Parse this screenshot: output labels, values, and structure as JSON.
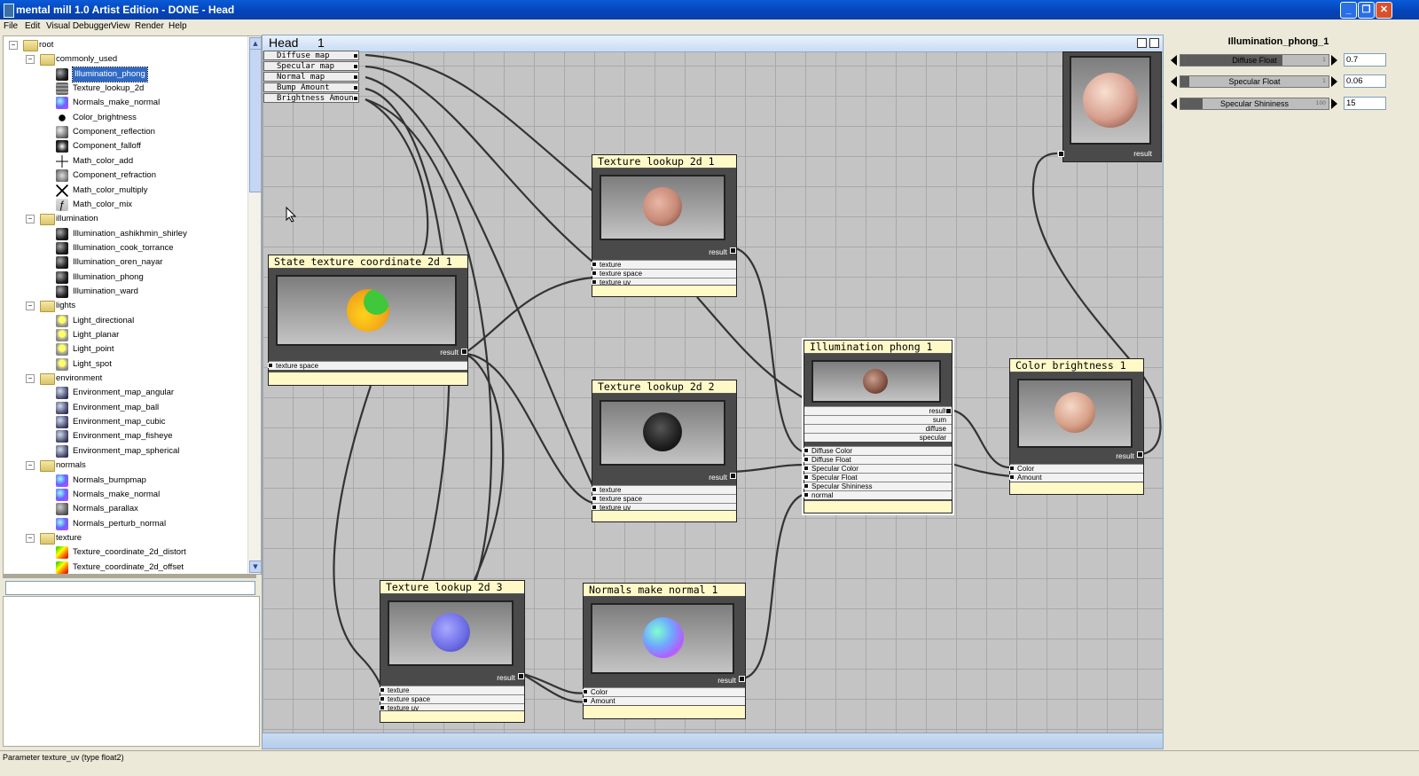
{
  "window": {
    "title": "mental mill 1.0 Artist Edition - DONE - Head"
  },
  "menu": [
    "File",
    "Edit",
    "Visual Debugger",
    "View",
    "Render",
    "Help"
  ],
  "tree": {
    "items": [
      {
        "label": "root",
        "level": 0,
        "type": "folder"
      },
      {
        "label": "commonly_used",
        "level": 1,
        "type": "folder"
      },
      {
        "label": "Illumination_phong",
        "level": 2,
        "type": "item",
        "icon": "dark-sphere-icon",
        "selected": true
      },
      {
        "label": "Texture_lookup_2d",
        "level": 2,
        "type": "item",
        "icon": "texture-grid-icon"
      },
      {
        "label": "Normals_make_normal",
        "level": 2,
        "type": "item",
        "icon": "normal-sphere-icon"
      },
      {
        "label": "Color_brightness",
        "level": 2,
        "type": "item",
        "icon": "sun-icon"
      },
      {
        "label": "Component_reflection",
        "level": 2,
        "type": "item",
        "icon": "reflection-sphere-icon"
      },
      {
        "label": "Component_falloff",
        "level": 2,
        "type": "item",
        "icon": "falloff-sphere-icon"
      },
      {
        "label": "Math_color_add",
        "level": 2,
        "type": "item",
        "icon": "plus-icon"
      },
      {
        "label": "Component_refraction",
        "level": 2,
        "type": "item",
        "icon": "refraction-sphere-icon"
      },
      {
        "label": "Math_color_multiply",
        "level": 2,
        "type": "item",
        "icon": "multiply-icon"
      },
      {
        "label": "Math_color_mix",
        "level": 2,
        "type": "item",
        "icon": "function-icon"
      },
      {
        "label": "illumination",
        "level": 1,
        "type": "folder"
      },
      {
        "label": "Illumination_ashikhmin_shirley",
        "level": 2,
        "type": "item",
        "icon": "dark-sphere-icon"
      },
      {
        "label": "Illumination_cook_torrance",
        "level": 2,
        "type": "item",
        "icon": "dark-sphere-icon"
      },
      {
        "label": "Illumination_oren_nayar",
        "level": 2,
        "type": "item",
        "icon": "dark-sphere-icon"
      },
      {
        "label": "Illumination_phong",
        "level": 2,
        "type": "item",
        "icon": "dark-sphere-icon"
      },
      {
        "label": "Illumination_ward",
        "level": 2,
        "type": "item",
        "icon": "dark-sphere-icon"
      },
      {
        "label": "lights",
        "level": 1,
        "type": "folder"
      },
      {
        "label": "Light_directional",
        "level": 2,
        "type": "item",
        "icon": "bulb-icon"
      },
      {
        "label": "Light_planar",
        "level": 2,
        "type": "item",
        "icon": "bulb-icon"
      },
      {
        "label": "Light_point",
        "level": 2,
        "type": "item",
        "icon": "bulb-icon"
      },
      {
        "label": "Light_spot",
        "level": 2,
        "type": "item",
        "icon": "bulb-icon"
      },
      {
        "label": "environment",
        "level": 1,
        "type": "folder"
      },
      {
        "label": "Environment_map_angular",
        "level": 2,
        "type": "item",
        "icon": "env-sphere-icon"
      },
      {
        "label": "Environment_map_ball",
        "level": 2,
        "type": "item",
        "icon": "env-sphere-icon"
      },
      {
        "label": "Environment_map_cubic",
        "level": 2,
        "type": "item",
        "icon": "env-sphere-icon"
      },
      {
        "label": "Environment_map_fisheye",
        "level": 2,
        "type": "item",
        "icon": "env-sphere-icon"
      },
      {
        "label": "Environment_map_spherical",
        "level": 2,
        "type": "item",
        "icon": "env-sphere-icon"
      },
      {
        "label": "normals",
        "level": 1,
        "type": "folder"
      },
      {
        "label": "Normals_bumpmap",
        "level": 2,
        "type": "item",
        "icon": "normal-sphere-icon"
      },
      {
        "label": "Normals_make_normal",
        "level": 2,
        "type": "item",
        "icon": "normal-sphere-icon"
      },
      {
        "label": "Normals_parallax",
        "level": 2,
        "type": "item",
        "icon": "parallax-icon"
      },
      {
        "label": "Normals_perturb_normal",
        "level": 2,
        "type": "item",
        "icon": "normal-sphere-icon"
      },
      {
        "label": "texture",
        "level": 1,
        "type": "folder"
      },
      {
        "label": "Texture_coordinate_2d_distort",
        "level": 2,
        "type": "item",
        "icon": "uv-gradient-icon"
      },
      {
        "label": "Texture_coordinate_2d_offset",
        "level": 2,
        "type": "item",
        "icon": "uv-gradient-icon"
      }
    ]
  },
  "graph": {
    "title": "Head",
    "number": "1",
    "parameters": [
      "Diffuse map",
      "Specular map",
      "Normal map",
      "Bump Amount",
      "Brightness Amoun"
    ],
    "nodes": {
      "state_tex": {
        "title": "State texture coordinate 2d 1",
        "result": "result",
        "inputs": [
          "texture space"
        ]
      },
      "tex1": {
        "title": "Texture lookup 2d 1",
        "result": "result",
        "inputs": [
          "texture",
          "texture space",
          "texture uv"
        ]
      },
      "tex2": {
        "title": "Texture lookup 2d 2",
        "result": "result",
        "inputs": [
          "texture",
          "texture space",
          "texture uv"
        ]
      },
      "tex3": {
        "title": "Texture lookup 2d 3",
        "result": "result",
        "inputs": [
          "texture",
          "texture space",
          "texture uv"
        ]
      },
      "normals": {
        "title": "Normals make normal 1",
        "result": "result",
        "inputs": [
          "Color",
          "Amount"
        ]
      },
      "phong": {
        "title": "Illumination phong 1",
        "outputs": [
          "result",
          "sum",
          "diffuse",
          "specular"
        ],
        "inputs": [
          "Diffuse Color",
          "Diffuse Float",
          "Specular Color",
          "Specular Float",
          "Specular Shininess",
          "normal"
        ]
      },
      "brightness": {
        "title": "Color brightness 1",
        "result": "result",
        "inputs": [
          "Color",
          "Amount"
        ]
      },
      "output": {
        "result": "result"
      }
    }
  },
  "inspector": {
    "title": "Illumination_phong_1",
    "params": [
      {
        "label": "Diffuse Float",
        "min": "0",
        "max": "1",
        "value": "0.7",
        "fraction": 0.7
      },
      {
        "label": "Specular Float",
        "min": "0",
        "max": "1",
        "value": "0.06",
        "fraction": 0.06
      },
      {
        "label": "Specular Shininess",
        "min": "0",
        "max": "100",
        "value": "15",
        "fraction": 0.15
      }
    ]
  },
  "status": "Parameter texture_uv (type float2)",
  "colors": {
    "titlebar": "#0a5bd8",
    "node_header": "#fff9c8",
    "node_body": "#4a4a4a",
    "graph_bg": "#c4c4c4",
    "selection": "#316ac5"
  }
}
